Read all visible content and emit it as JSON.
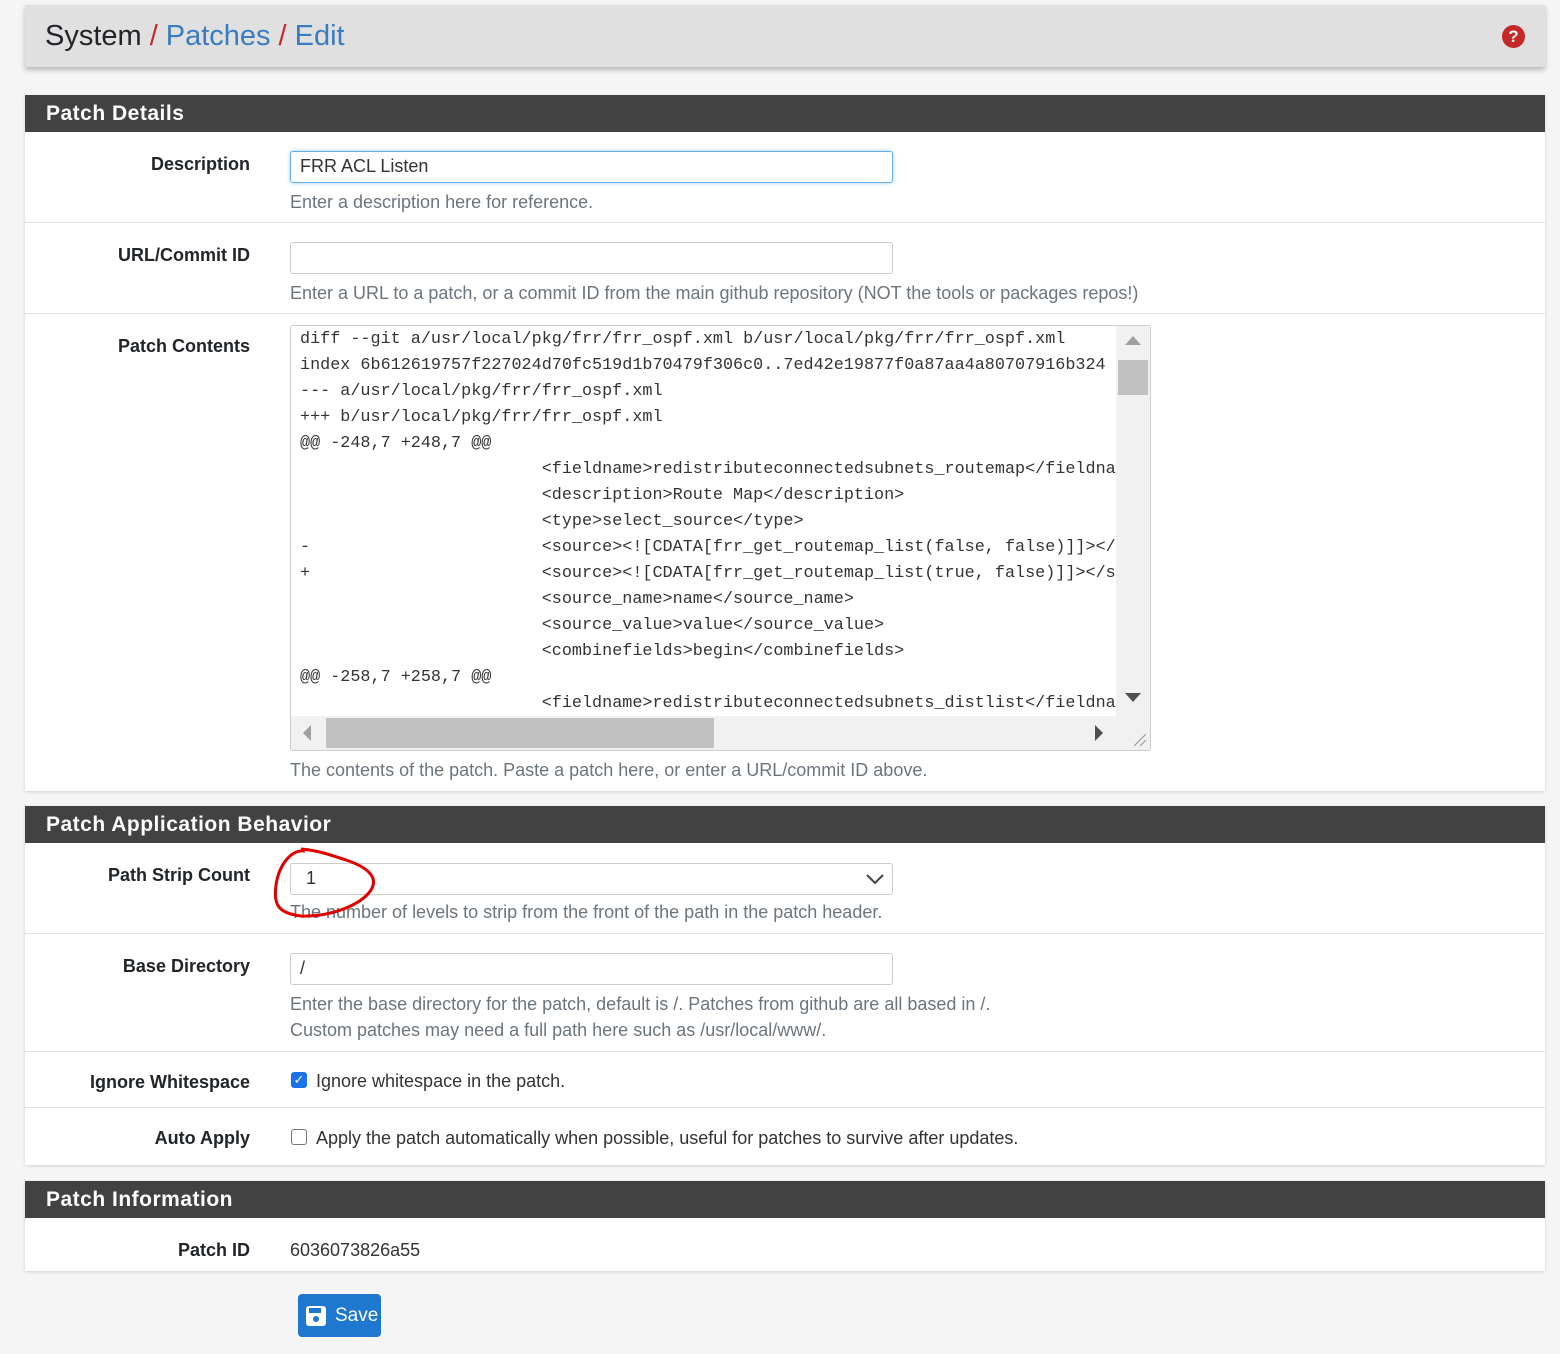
{
  "breadcrumb": {
    "root": "System",
    "items": [
      "Patches",
      "Edit"
    ],
    "separator": "/"
  },
  "help_icon": "question-circle-icon",
  "patch_details": {
    "title": "Patch Details",
    "description": {
      "label": "Description",
      "value": "FRR ACL Listen",
      "help": "Enter a description here for reference."
    },
    "url": {
      "label": "URL/Commit ID",
      "value": "",
      "help": "Enter a URL to a patch, or a commit ID from the main github repository (NOT the tools or packages repos!)"
    },
    "contents": {
      "label": "Patch Contents",
      "help": "The contents of the patch. Paste a patch here, or enter a URL/commit ID above.",
      "lines": [
        "diff --git a/usr/local/pkg/frr/frr_ospf.xml b/usr/local/pkg/frr/frr_ospf.xml",
        "index 6b612619757f227024d70fc519d1b70479f306c0..7ed42e19877f0a87aa4a80707916b324",
        "--- a/usr/local/pkg/frr/frr_ospf.xml",
        "+++ b/usr/local/pkg/frr/frr_ospf.xml",
        "@@ -248,7 +248,7 @@",
        " \t\t\t<fieldname>redistributeconnectedsubnets_routemap</fieldname>",
        " \t\t\t<description>Route Map</description>",
        " \t\t\t<type>select_source</type>",
        "-\t\t\t<source><![CDATA[frr_get_routemap_list(false, false)]]></source>",
        "+\t\t\t<source><![CDATA[frr_get_routemap_list(true, false)]]></source>",
        " \t\t\t<source_name>name</source_name>",
        " \t\t\t<source_value>value</source_value>",
        " \t\t\t<combinefields>begin</combinefields>",
        "@@ -258,7 +258,7 @@",
        " \t\t\t<fieldname>redistributeconnectedsubnets_distlist</fieldname>"
      ]
    }
  },
  "behavior": {
    "title": "Patch Application Behavior",
    "strip": {
      "label": "Path Strip Count",
      "value": "1",
      "help": "The number of levels to strip from the front of the path in the patch header."
    },
    "basedir": {
      "label": "Base Directory",
      "value": "/",
      "help1": "Enter the base directory for the patch, default is /. Patches from github are all based in /.",
      "help2": "Custom patches may need a full path here such as /usr/local/www/."
    },
    "ignore_ws": {
      "label": "Ignore Whitespace",
      "text": "Ignore whitespace in the patch.",
      "checked": true
    },
    "auto_apply": {
      "label": "Auto Apply",
      "text": "Apply the patch automatically when possible, useful for patches to survive after updates.",
      "checked": false
    }
  },
  "info": {
    "title": "Patch Information",
    "id_label": "Patch ID",
    "id_value": "6036073826a55"
  },
  "save_label": "Save",
  "colors": {
    "accent": "#1e78d0",
    "header_bar": "#424242",
    "breadcrumb_sep": "#c62828",
    "annotation": "#e00000"
  }
}
